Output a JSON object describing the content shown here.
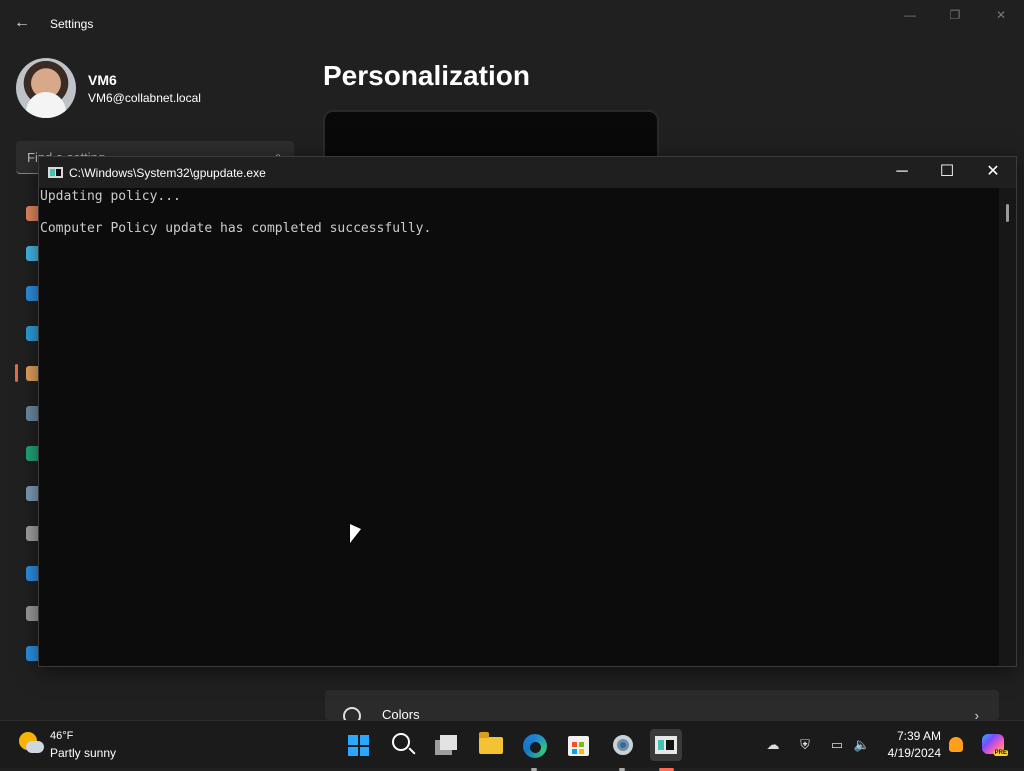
{
  "settings": {
    "title": "Settings",
    "back_glyph": "←",
    "window_controls": {
      "minimize": "—",
      "restore": "❐",
      "close": "✕"
    },
    "user": {
      "name": "VM6",
      "email": "VM6@collabnet.local"
    },
    "search": {
      "placeholder": "Find a setting",
      "icon": "search-icon"
    },
    "page_title": "Personalization",
    "card": {
      "label": "Colors",
      "chevron": "›"
    }
  },
  "nav_icons": [
    {
      "name": "home-icon",
      "color": "#e3865e"
    },
    {
      "name": "system-icon",
      "color": "#44b6e6"
    },
    {
      "name": "bluetooth-icon",
      "color": "#2b8fe0"
    },
    {
      "name": "network-icon",
      "color": "#2e9ed9"
    },
    {
      "name": "personalization-icon",
      "color": "#e3a05e"
    },
    {
      "name": "apps-icon",
      "color": "#6f8aa3"
    },
    {
      "name": "accounts-icon",
      "color": "#22a578"
    },
    {
      "name": "time-language-icon",
      "color": "#7f9bb8"
    },
    {
      "name": "gaming-icon",
      "color": "#a0a0a0"
    },
    {
      "name": "accessibility-icon",
      "color": "#2b8fe0"
    },
    {
      "name": "privacy-security-icon",
      "color": "#9a9a9a"
    },
    {
      "name": "windows-update-icon",
      "color": "#2b8fe0"
    }
  ],
  "console": {
    "title": "C:\\Windows\\System32\\gpupdate.exe",
    "controls": {
      "minimize": "─",
      "maximize": "☐",
      "close": "✕"
    },
    "lines": [
      "Updating policy...",
      "",
      "Computer Policy update has completed successfully."
    ]
  },
  "taskbar": {
    "weather": {
      "temp": "46°F",
      "description": "Partly sunny"
    },
    "apps": [
      {
        "name": "start-icon",
        "active": false
      },
      {
        "name": "search-icon",
        "active": false
      },
      {
        "name": "task-view-icon",
        "active": false
      },
      {
        "name": "file-explorer-icon",
        "active": false
      },
      {
        "name": "edge-icon",
        "active": false
      },
      {
        "name": "microsoft-store-icon",
        "active": false
      },
      {
        "name": "settings-icon",
        "active": false
      },
      {
        "name": "console-icon",
        "active": true
      }
    ],
    "tray": {
      "icons": [
        "onedrive-icon",
        "defender-icon",
        "display-icon",
        "volume-icon"
      ],
      "time": "7:39 AM",
      "date": "4/19/2024"
    }
  },
  "colors": {
    "background": "#202020",
    "console_background": "#0c0c0c",
    "accent_active": "#ff6a55",
    "windows_blue": "#2aa8ff"
  }
}
